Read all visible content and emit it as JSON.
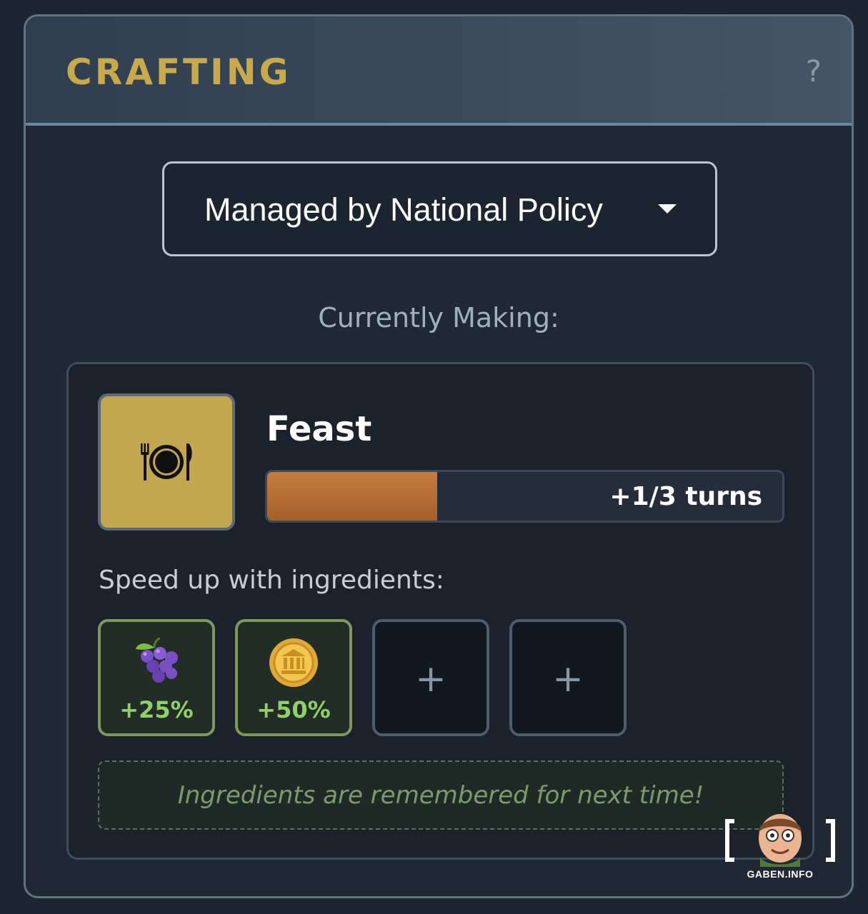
{
  "header": {
    "title": "CRAFTING",
    "help_label": "?"
  },
  "policy_dropdown": {
    "selected": "Managed by National Policy"
  },
  "currently_making_label": "Currently Making:",
  "craft": {
    "item_name": "Feast",
    "item_icon": "plate-cutlery-icon",
    "progress_text": "+1/3 turns",
    "progress_fraction": 0.33
  },
  "ingredients": {
    "label": "Speed up with ingredients:",
    "slots": [
      {
        "state": "filled",
        "icon": "grapes-icon",
        "bonus": "+25%"
      },
      {
        "state": "filled",
        "icon": "coin-icon",
        "bonus": "+50%"
      },
      {
        "state": "empty",
        "add_label": "+"
      },
      {
        "state": "empty",
        "add_label": "+"
      }
    ],
    "note": "Ingredients are remembered for next time!"
  },
  "watermark": {
    "text": "GABEN.INFO"
  },
  "colors": {
    "title_gold": "#c9a94a",
    "progress_orange": "#c77d3e",
    "bonus_green": "#8fd06c",
    "item_bg": "#c2a650"
  }
}
